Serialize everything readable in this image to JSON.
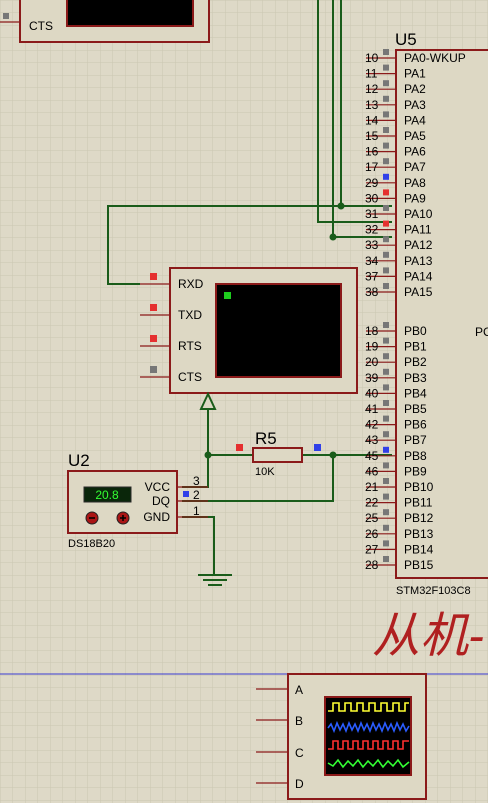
{
  "mcu": {
    "ref": "U5",
    "part": "STM32F103C8",
    "cut_label": "PC",
    "pins": [
      {
        "num": "10",
        "name": "PA0-WKUP",
        "state": "gray"
      },
      {
        "num": "11",
        "name": "PA1",
        "state": "gray"
      },
      {
        "num": "12",
        "name": "PA2",
        "state": "gray"
      },
      {
        "num": "13",
        "name": "PA3",
        "state": "gray"
      },
      {
        "num": "14",
        "name": "PA4",
        "state": "gray"
      },
      {
        "num": "15",
        "name": "PA5",
        "state": "gray"
      },
      {
        "num": "16",
        "name": "PA6",
        "state": "gray"
      },
      {
        "num": "17",
        "name": "PA7",
        "state": "gray"
      },
      {
        "num": "29",
        "name": "PA8",
        "state": "blue"
      },
      {
        "num": "30",
        "name": "PA9",
        "state": "red"
      },
      {
        "num": "31",
        "name": "PA10",
        "state": "gray"
      },
      {
        "num": "32",
        "name": "PA11",
        "state": "red"
      },
      {
        "num": "33",
        "name": "PA12",
        "state": "gray"
      },
      {
        "num": "34",
        "name": "PA13",
        "state": "gray"
      },
      {
        "num": "37",
        "name": "PA14",
        "state": "gray"
      },
      {
        "num": "38",
        "name": "PA15",
        "state": "gray"
      },
      {
        "num": "18",
        "name": "PB0",
        "state": "gray"
      },
      {
        "num": "19",
        "name": "PB1",
        "state": "gray"
      },
      {
        "num": "20",
        "name": "PB2",
        "state": "gray"
      },
      {
        "num": "39",
        "name": "PB3",
        "state": "gray"
      },
      {
        "num": "40",
        "name": "PB4",
        "state": "gray"
      },
      {
        "num": "41",
        "name": "PB5",
        "state": "gray"
      },
      {
        "num": "42",
        "name": "PB6",
        "state": "gray"
      },
      {
        "num": "43",
        "name": "PB7",
        "state": "gray"
      },
      {
        "num": "45",
        "name": "PB8",
        "state": "blue"
      },
      {
        "num": "46",
        "name": "PB9",
        "state": "gray"
      },
      {
        "num": "21",
        "name": "PB10",
        "state": "gray"
      },
      {
        "num": "22",
        "name": "PB11",
        "state": "gray"
      },
      {
        "num": "25",
        "name": "PB12",
        "state": "gray"
      },
      {
        "num": "26",
        "name": "PB13",
        "state": "gray"
      },
      {
        "num": "27",
        "name": "PB14",
        "state": "gray"
      },
      {
        "num": "28",
        "name": "PB15",
        "state": "gray"
      }
    ]
  },
  "terminal_top": {
    "cts_label": "CTS"
  },
  "terminal_main": {
    "pins": [
      {
        "name": "RXD",
        "state": "red"
      },
      {
        "name": "TXD",
        "state": "red"
      },
      {
        "name": "RTS",
        "state": "red"
      },
      {
        "name": "CTS",
        "state": "gray"
      }
    ]
  },
  "resistor": {
    "ref": "R5",
    "value": "10K"
  },
  "sensor": {
    "ref": "U2",
    "part": "DS18B20",
    "reading": "20.8",
    "pins": [
      {
        "name": "VCC",
        "num": "3"
      },
      {
        "name": "DQ",
        "num": "2"
      },
      {
        "name": "GND",
        "num": "1"
      }
    ]
  },
  "title_text": "从机-",
  "scope": {
    "channels": [
      "A",
      "B",
      "C",
      "D"
    ]
  },
  "colors": {
    "wire": "#1a5c1a",
    "border": "#8b1a1a",
    "body": "#ddd8c4",
    "grid": "#cfcab6",
    "pin_red": "#e53030",
    "pin_blue": "#3040e8",
    "pin_gray": "#777777",
    "title": "#b02020"
  }
}
